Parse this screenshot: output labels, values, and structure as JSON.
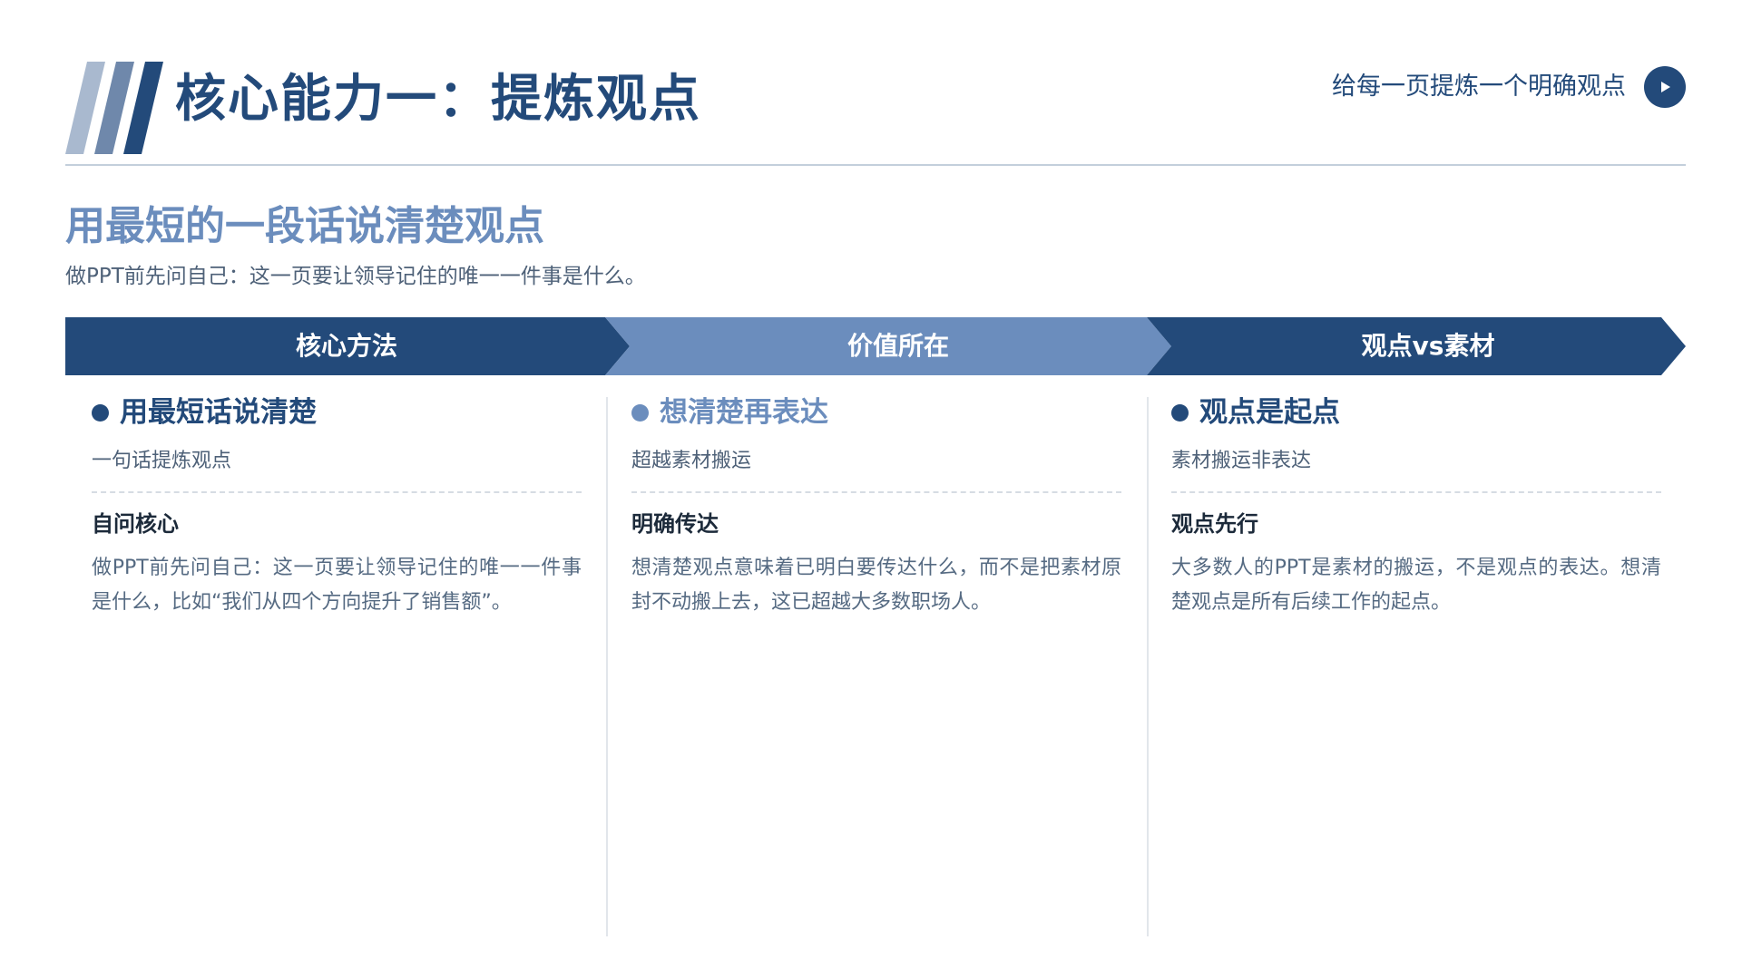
{
  "header": {
    "title": "核心能力一：提炼观点",
    "tagline": "给每一页提炼一个明确观点"
  },
  "section": {
    "subtitle": "用最短的一段话说清楚观点",
    "intro": "做PPT前先问自己：这一页要让领导记住的唯一一件事是什么。"
  },
  "colors": {
    "primary": "#234a7a",
    "accent": "#6b8dbd",
    "stripe_light": "#a9b9cf",
    "stripe_mid": "#6f88ab"
  },
  "band": [
    "核心方法",
    "价值所在",
    "观点vs素材"
  ],
  "columns": [
    {
      "title": "用最短话说清楚",
      "subtitle": "一句话提炼观点",
      "point_title": "自问核心",
      "point_body": "做PPT前先问自己：这一页要让领导记住的唯一一件事是什么，比如“我们从四个方向提升了销售额”。"
    },
    {
      "title": "想清楚再表达",
      "subtitle": "超越素材搬运",
      "point_title": "明确传达",
      "point_body": "想清楚观点意味着已明白要传达什么，而不是把素材原封不动搬上去，这已超越大多数职场人。"
    },
    {
      "title": "观点是起点",
      "subtitle": "素材搬运非表达",
      "point_title": "观点先行",
      "point_body": "大多数人的PPT是素材的搬运，不是观点的表达。想清楚观点是所有后续工作的起点。"
    }
  ]
}
